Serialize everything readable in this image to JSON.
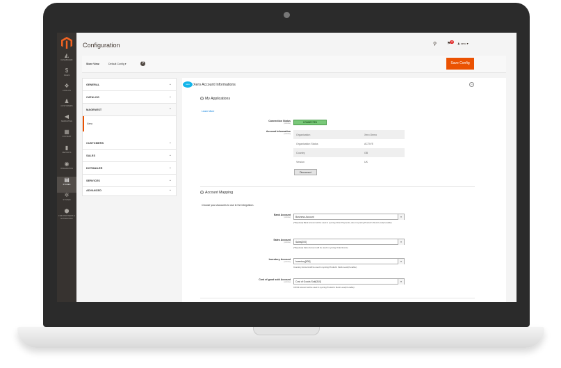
{
  "menu": {
    "items": [
      {
        "label": "DASHBOARD",
        "icon": "dashboard-icon",
        "glyph": "◭"
      },
      {
        "label": "SALES",
        "icon": "dollar-icon",
        "glyph": "$"
      },
      {
        "label": "CATALOG",
        "icon": "box-icon",
        "glyph": "❖"
      },
      {
        "label": "CUSTOMERS",
        "icon": "person-icon",
        "glyph": "♟"
      },
      {
        "label": "MARKETING",
        "icon": "megaphone-icon",
        "glyph": "◀"
      },
      {
        "label": "CONTENT",
        "icon": "layout-icon",
        "glyph": "▦"
      },
      {
        "label": "REPORTS",
        "icon": "bar-chart-icon",
        "glyph": "▮"
      },
      {
        "label": "INTEGRATION",
        "icon": "integration-icon",
        "glyph": "◉"
      },
      {
        "label": "STORES",
        "icon": "store-icon",
        "glyph": "▤"
      },
      {
        "label": "SYSTEM",
        "icon": "gear-icon",
        "glyph": "✲"
      },
      {
        "label": "FIND PARTNERS & EXTENSIONS",
        "icon": "extensions-icon",
        "glyph": "⬢"
      }
    ]
  },
  "header": {
    "title": "Configuration",
    "notifications_count": "10",
    "user": "xero"
  },
  "store_view": {
    "label": "Store View:",
    "value": "Default Config",
    "save_label": "Save Config"
  },
  "tabs": {
    "items": [
      "GENERAL",
      "CATALOG",
      "MAGENEST",
      "CUSTOMERS",
      "SALES",
      "DOTMAILER",
      "SERVICES",
      "ADVANCED"
    ],
    "sub_item": "Xero"
  },
  "section": {
    "badge": "xero",
    "title": "Xero Account Informations",
    "my_apps_title": "My Applications",
    "learn_more": "Learn More",
    "connection_label": "Connection Status",
    "connection_value": "CONNECTED",
    "account_info_label": "Account Information",
    "scope": "[website]",
    "info_rows": [
      {
        "key": "Organisation",
        "value": "Xero Demo"
      },
      {
        "key": "Organisation Status",
        "value": "ACTIVE"
      },
      {
        "key": "Country",
        "value": "GB"
      },
      {
        "key": "Version",
        "value": "UK"
      }
    ],
    "disconnect_label": "Disconnect",
    "mapping_title": "Account Mapping",
    "mapping_note": "Choose your Accounts to use in the integration.",
    "mapping_fields": [
      {
        "label": "Bank Account",
        "value": "Business Account",
        "note": "[*Required] Bank Account will be used in syncing Order Payments, also in syncing Product's Stock Level(if enable)"
      },
      {
        "label": "Sales Account",
        "value": "Sales[200]",
        "note": "[*Required] Sales Account will be used in syncing Order/Invoice"
      },
      {
        "label": "Inventory Account",
        "value": "Inventory[630]",
        "note": "Inventory Account will be used in syncing Product's Stock Level(if enable)."
      },
      {
        "label": "Cost of good sold Account",
        "value": "Cost of Goods Sold[310]",
        "note": "COGS Account will be used in syncing Product's Stock Level(if enable)."
      }
    ]
  },
  "colors": {
    "accent": "#eb5202",
    "menu_bg": "#373330",
    "connected": "#79c879",
    "link": "#007bdb"
  }
}
